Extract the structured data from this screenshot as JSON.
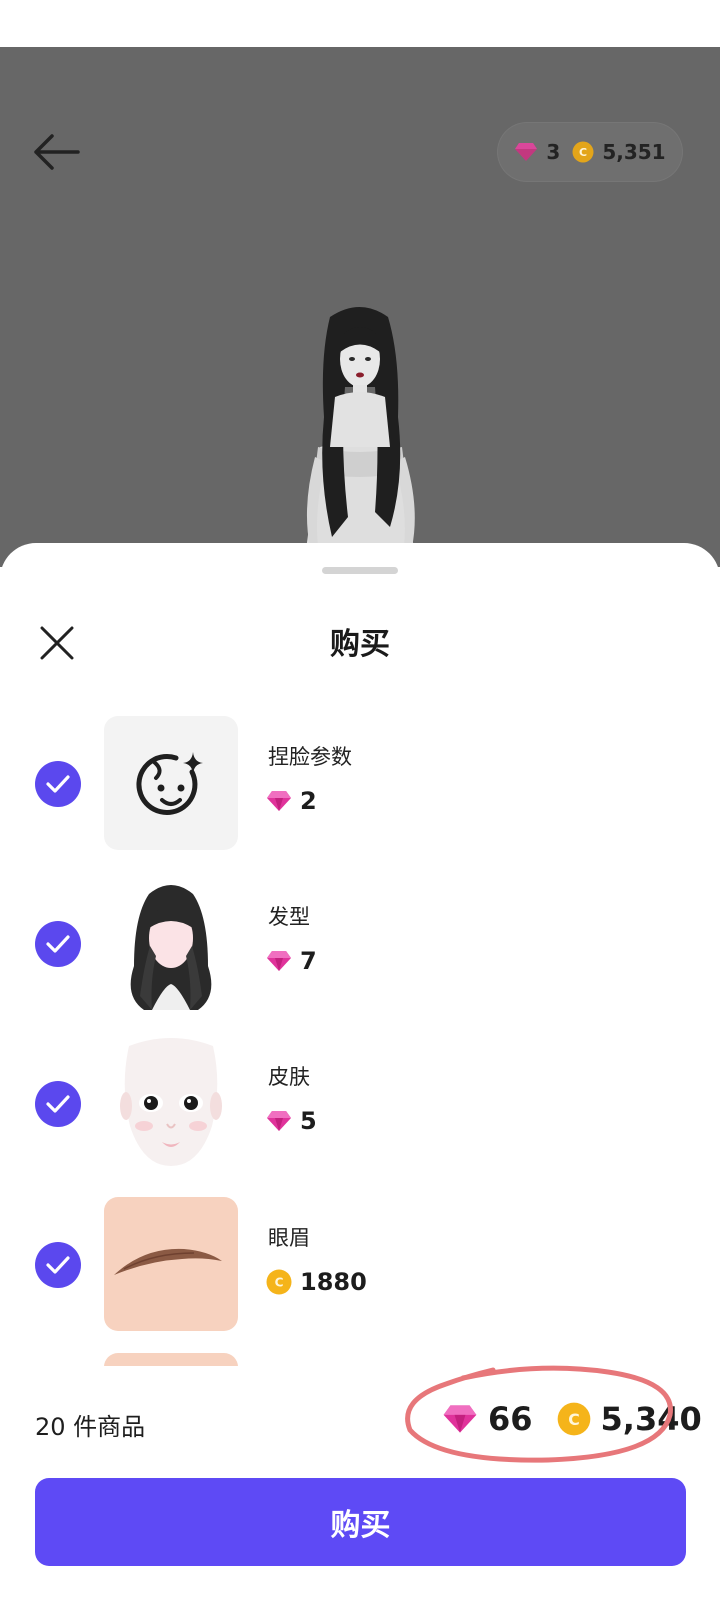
{
  "header": {
    "gems": "3",
    "coins": "5,351",
    "back_icon": "arrow-left-icon"
  },
  "sheet": {
    "title": "购买",
    "close_icon": "close-icon"
  },
  "items": [
    {
      "name": "捏脸参数",
      "currency": "gem",
      "price": "2",
      "selected": true,
      "thumb": "face-sparkle-icon"
    },
    {
      "name": "发型",
      "currency": "gem",
      "price": "7",
      "selected": true,
      "thumb": "hairstyle"
    },
    {
      "name": "皮肤",
      "currency": "gem",
      "price": "5",
      "selected": true,
      "thumb": "skin-face"
    },
    {
      "name": "眼眉",
      "currency": "coin",
      "price": "1880",
      "selected": true,
      "thumb": "eyebrow"
    }
  ],
  "footer": {
    "count_label": "20 件商品",
    "total_gems": "66",
    "total_coins": "5,340",
    "buy_label": "购买"
  },
  "colors": {
    "accent": "#5e4af5",
    "checkbox": "#5b48ee",
    "gem": "#e0339b",
    "coin": "#f5b41a",
    "annotation": "#e7777a"
  }
}
